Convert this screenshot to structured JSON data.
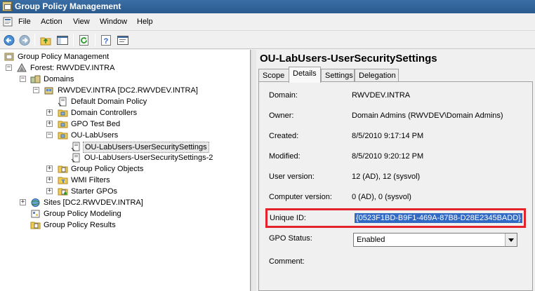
{
  "window": {
    "title": "Group Policy Management"
  },
  "menu": {
    "items": [
      "File",
      "Action",
      "View",
      "Window",
      "Help"
    ]
  },
  "toolbar": {
    "buttons": [
      "back-icon",
      "forward-icon",
      "up-folder-icon",
      "show-hide-tree-icon",
      "refresh-icon",
      "help-icon",
      "properties-icon"
    ]
  },
  "tree": {
    "items": [
      {
        "label": "Group Policy Management",
        "icon": "gpm-console-icon",
        "expander": ""
      },
      {
        "label": "Forest: RWVDEV.INTRA",
        "icon": "forest-icon",
        "expander": "−"
      },
      {
        "label": "Domains",
        "icon": "domains-icon",
        "expander": "−"
      },
      {
        "label": "RWVDEV.INTRA [DC2.RWVDEV.INTRA]",
        "icon": "domain-icon",
        "expander": "−"
      },
      {
        "label": "Default Domain Policy",
        "icon": "gpo-link-icon",
        "expander": ""
      },
      {
        "label": "Domain Controllers",
        "icon": "ou-folder-icon",
        "expander": "+"
      },
      {
        "label": "GPO Test Bed",
        "icon": "ou-folder-icon",
        "expander": "+"
      },
      {
        "label": "OU-LabUsers",
        "icon": "ou-folder-icon",
        "expander": "−"
      },
      {
        "label": "OU-LabUsers-UserSecuritySettings",
        "icon": "gpo-link-icon",
        "expander": "",
        "selected": true
      },
      {
        "label": "OU-LabUsers-UserSecuritySettings-2",
        "icon": "gpo-link-icon",
        "expander": ""
      },
      {
        "label": "Group Policy Objects",
        "icon": "gpo-folder-icon",
        "expander": "+"
      },
      {
        "label": "WMI Filters",
        "icon": "wmi-folder-icon",
        "expander": "+"
      },
      {
        "label": "Starter GPOs",
        "icon": "starter-gpo-folder-icon",
        "expander": "+"
      },
      {
        "label": "Sites [DC2.RWVDEV.INTRA]",
        "icon": "sites-icon",
        "expander": "+"
      },
      {
        "label": "Group Policy Modeling",
        "icon": "modeling-icon",
        "expander": ""
      },
      {
        "label": "Group Policy Results",
        "icon": "results-icon",
        "expander": ""
      }
    ]
  },
  "details": {
    "heading": "OU-LabUsers-UserSecuritySettings",
    "tabs": [
      "Scope",
      "Details",
      "Settings",
      "Delegation"
    ],
    "active_tab": "Details",
    "fields": {
      "domain": {
        "label": "Domain:",
        "value": "RWVDEV.INTRA"
      },
      "owner": {
        "label": "Owner:",
        "value": "Domain Admins (RWVDEV\\Domain Admins)"
      },
      "created": {
        "label": "Created:",
        "value": "8/5/2010 9:17:14 PM"
      },
      "modified": {
        "label": "Modified:",
        "value": "8/5/2010 9:20:12 PM"
      },
      "user_version": {
        "label": "User version:",
        "value": "12 (AD), 12 (sysvol)"
      },
      "computer_version": {
        "label": "Computer version:",
        "value": "0 (AD), 0 (sysvol)"
      },
      "unique_id": {
        "label": "Unique ID:",
        "value": "{0523F1BD-B9F1-469A-87B8-D28E2345BADD}"
      },
      "gpo_status": {
        "label": "GPO Status:",
        "value": "Enabled"
      },
      "comment": {
        "label": "Comment:",
        "value": ""
      }
    }
  },
  "colors": {
    "highlight_box": "#e4222b",
    "selection": "#316ac5",
    "titlebar": "#3a6ea5"
  }
}
